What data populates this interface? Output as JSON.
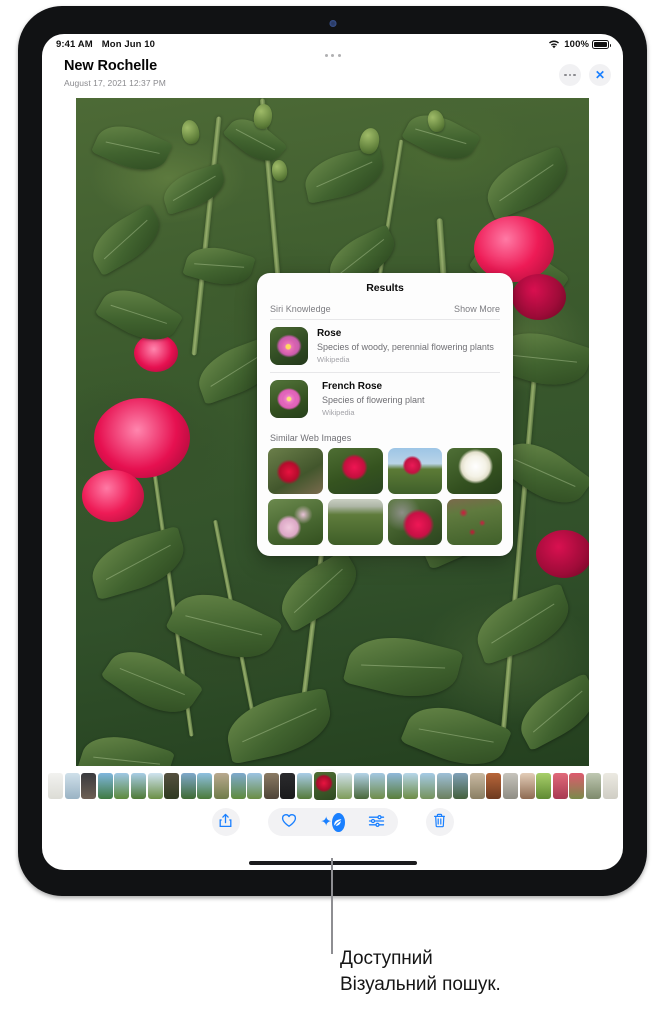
{
  "status_bar": {
    "time": "9:41 AM",
    "date": "Mon Jun 10",
    "wifi_icon": "wifi-icon",
    "battery_percent": "100%",
    "battery_icon": "battery-full-icon"
  },
  "header": {
    "title": "New Rochelle",
    "subtitle": "August 17, 2021  12:37 PM",
    "more_button": {
      "name": "more-options-button",
      "icon": "ellipsis-icon"
    },
    "close_button": {
      "name": "close-button",
      "icon": "close-x-icon",
      "label": "✕",
      "color": "#1a80ff"
    }
  },
  "results_popup": {
    "title": "Results",
    "siri_knowledge": {
      "section_label": "Siri Knowledge",
      "show_more_label": "Show More",
      "rows": [
        {
          "name": "Rose",
          "description": "Species of woody, perennial flowering plants",
          "source": "Wikipedia",
          "thumbnail_icon": "rose-thumbnail-icon"
        },
        {
          "name": "French Rose",
          "description": "Species of flowering plant",
          "source": "Wikipedia",
          "thumbnail_icon": "french-rose-thumbnail-icon"
        }
      ]
    },
    "similar_web_images": {
      "section_label": "Similar Web Images",
      "count": 8,
      "thumbnails": [
        "red-rose-closeup",
        "pink-rose-bush",
        "rose-with-sky",
        "white-roses",
        "pale-pink-roses",
        "rose-foliage",
        "magenta-rose-buds",
        "rose-shrub-with-label"
      ]
    }
  },
  "toolbar": {
    "share_button": {
      "label": "Share",
      "icon": "share-up-arrow-icon"
    },
    "favorite_button": {
      "label": "Favorite",
      "icon": "heart-icon"
    },
    "visual_look_up_button": {
      "label": "Visual Look Up",
      "icon": "visual-look-up-leaf-icon",
      "active": true,
      "accent": "#1a80ff"
    },
    "adjust_button": {
      "label": "Adjust",
      "icon": "sliders-icon"
    },
    "delete_button": {
      "label": "Delete",
      "icon": "trash-icon"
    }
  },
  "filmstrip": {
    "selected_index": 16,
    "thumb_count": 34
  },
  "callout": {
    "caption_line1": "Доступний",
    "caption_line2": "Візуальний пошук."
  },
  "colors": {
    "accent": "#1a80ff",
    "page_bg": "#ffffff",
    "device_bezel": "#111214",
    "control_bg": "#f2f2f4",
    "secondary_text": "#7c7c81"
  }
}
